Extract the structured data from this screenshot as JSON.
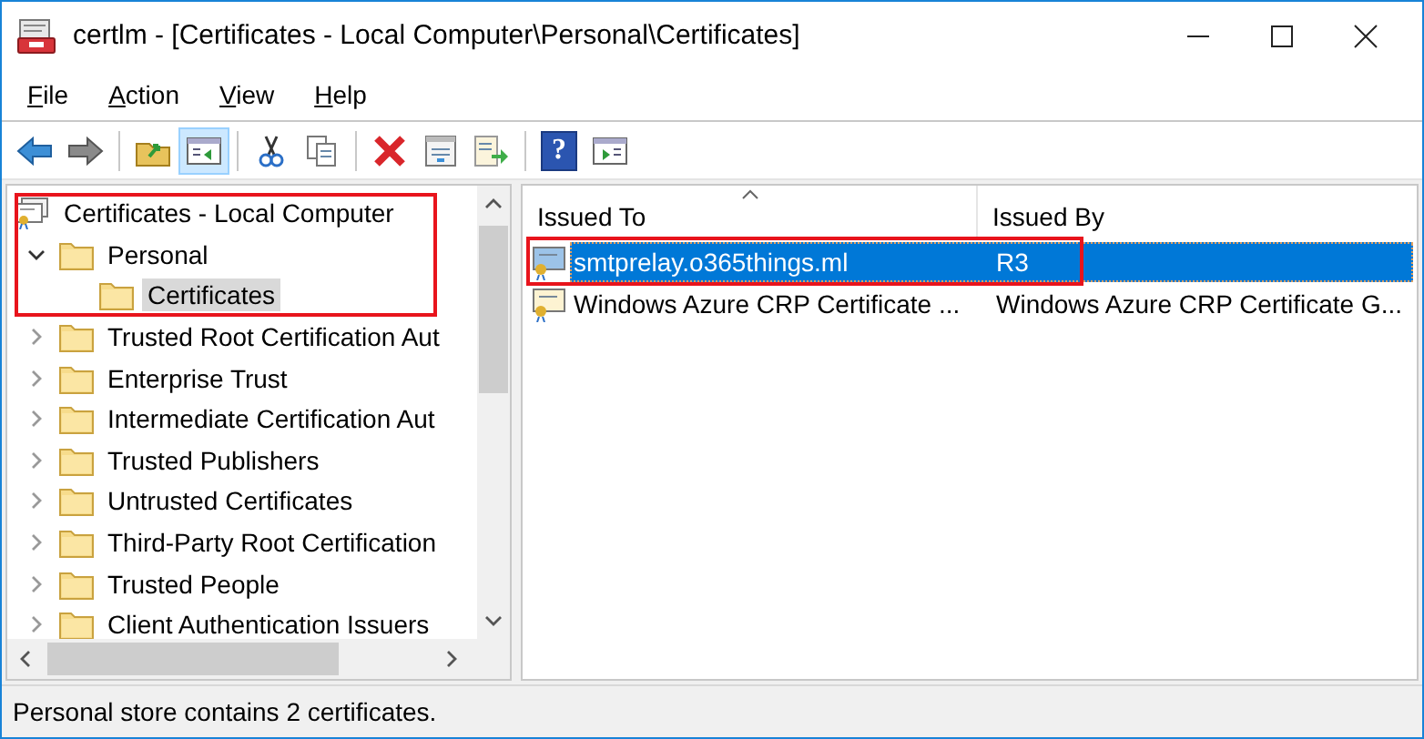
{
  "window": {
    "title": "certlm - [Certificates - Local Computer\\Personal\\Certificates]"
  },
  "menu": [
    "File",
    "Action",
    "View",
    "Help"
  ],
  "toolbar": [
    {
      "kind": "back",
      "pressed": false
    },
    {
      "kind": "forward",
      "pressed": false
    },
    {
      "kind": "separator"
    },
    {
      "kind": "up",
      "pressed": false
    },
    {
      "kind": "tree-toggle",
      "pressed": true
    },
    {
      "kind": "separator"
    },
    {
      "kind": "cut",
      "pressed": false
    },
    {
      "kind": "copy",
      "pressed": false
    },
    {
      "kind": "separator"
    },
    {
      "kind": "delete",
      "pressed": false
    },
    {
      "kind": "properties",
      "pressed": false
    },
    {
      "kind": "export",
      "pressed": false
    },
    {
      "kind": "separator"
    },
    {
      "kind": "help",
      "pressed": false,
      "label": "?"
    },
    {
      "kind": "action-pane",
      "pressed": false
    }
  ],
  "tree": {
    "label": "Certificates - Local Computer",
    "highlighted": true,
    "children": [
      {
        "label": "Personal",
        "expanded": true,
        "selected": false,
        "highlighted": true,
        "children": [
          {
            "label": "Certificates",
            "selected": true,
            "highlighted": true
          }
        ]
      },
      {
        "label": "Trusted Root Certification Aut",
        "expanded": false,
        "selected": false,
        "highlighted": false
      },
      {
        "label": "Enterprise Trust",
        "expanded": false,
        "selected": false,
        "highlighted": false
      },
      {
        "label": "Intermediate Certification Aut",
        "expanded": false,
        "selected": false,
        "highlighted": false
      },
      {
        "label": "Trusted Publishers",
        "expanded": false,
        "selected": false,
        "highlighted": false
      },
      {
        "label": "Untrusted Certificates",
        "expanded": false,
        "selected": false,
        "highlighted": false
      },
      {
        "label": "Third-Party Root Certification",
        "expanded": false,
        "selected": false,
        "highlighted": false
      },
      {
        "label": "Trusted People",
        "expanded": false,
        "selected": false,
        "highlighted": false
      },
      {
        "label": "Client Authentication Issuers",
        "expanded": false,
        "selected": false,
        "highlighted": false
      }
    ]
  },
  "table": {
    "columns": [
      {
        "label": "Issued To",
        "sorted": true
      },
      {
        "label": "Issued By",
        "sorted": false
      }
    ],
    "rows": [
      {
        "issued_to": "smtprelay.o365things.ml",
        "issued_by": "R3",
        "selected": true,
        "highlighted": true
      },
      {
        "issued_to": "Windows Azure CRP Certificate ...",
        "issued_by": "Windows Azure CRP Certificate G...",
        "selected": false,
        "highlighted": false
      }
    ]
  },
  "status_bar": "Personal store contains 2 certificates."
}
